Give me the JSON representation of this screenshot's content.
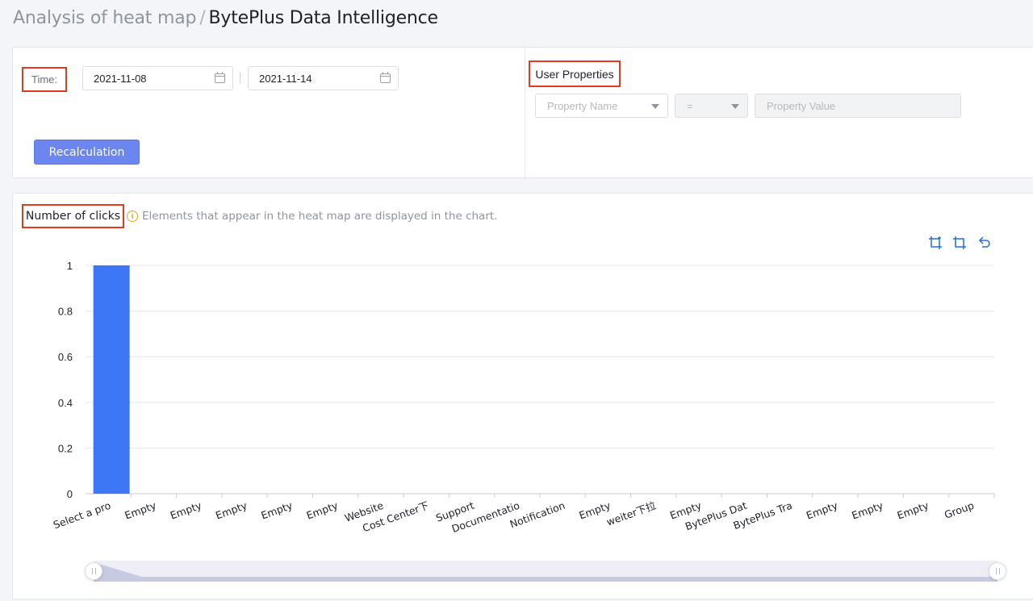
{
  "breadcrumb": {
    "parent": "Analysis of heat map",
    "separator": "/",
    "current": "BytePlus Data Intelligence"
  },
  "filters": {
    "time_label": "Time:",
    "start_date": "2021-11-08",
    "end_date": "2021-11-14",
    "recalc_label": "Recalculation",
    "user_properties_label": "User Properties",
    "property_name_placeholder": "Property Name",
    "operator_value": "=",
    "property_value_placeholder": "Property Value"
  },
  "chart_header": {
    "title": "Number of clicks",
    "info_icon": "info-circle-icon",
    "hint": "Elements that appear in the heat map are displayed in the chart."
  },
  "toolbox": {
    "icons": [
      "zoom-select-icon",
      "zoom-reset-icon",
      "undo-icon"
    ],
    "color": "#1f6fe0"
  },
  "colors": {
    "bar": "#3d76f6",
    "highlight": "#e2391f",
    "primary_button": "#6b86ee"
  },
  "chart_data": {
    "type": "bar",
    "title": "Number of clicks",
    "categories": [
      "Select a pro",
      "Empty",
      "Empty",
      "Empty",
      "Empty",
      "Empty",
      "Website",
      "Cost Center下",
      "Support",
      "Documentatio",
      "Notification",
      "Empty",
      "weiter下拉",
      "Empty",
      "BytePlus Dat",
      "BytePlus Tra",
      "Empty",
      "Empty",
      "Empty",
      "Group"
    ],
    "values": [
      1,
      0,
      0,
      0,
      0,
      0,
      0,
      0,
      0,
      0,
      0,
      0,
      0,
      0,
      0,
      0,
      0,
      0,
      0,
      0
    ],
    "yticks": [
      "0",
      "0.2",
      "0.4",
      "0.6",
      "0.8",
      "1"
    ],
    "ylim": [
      0,
      1
    ],
    "grid": true,
    "xlabel_rotation": -20
  },
  "data_zoom": {
    "start_percent": 0,
    "end_percent": 100
  }
}
